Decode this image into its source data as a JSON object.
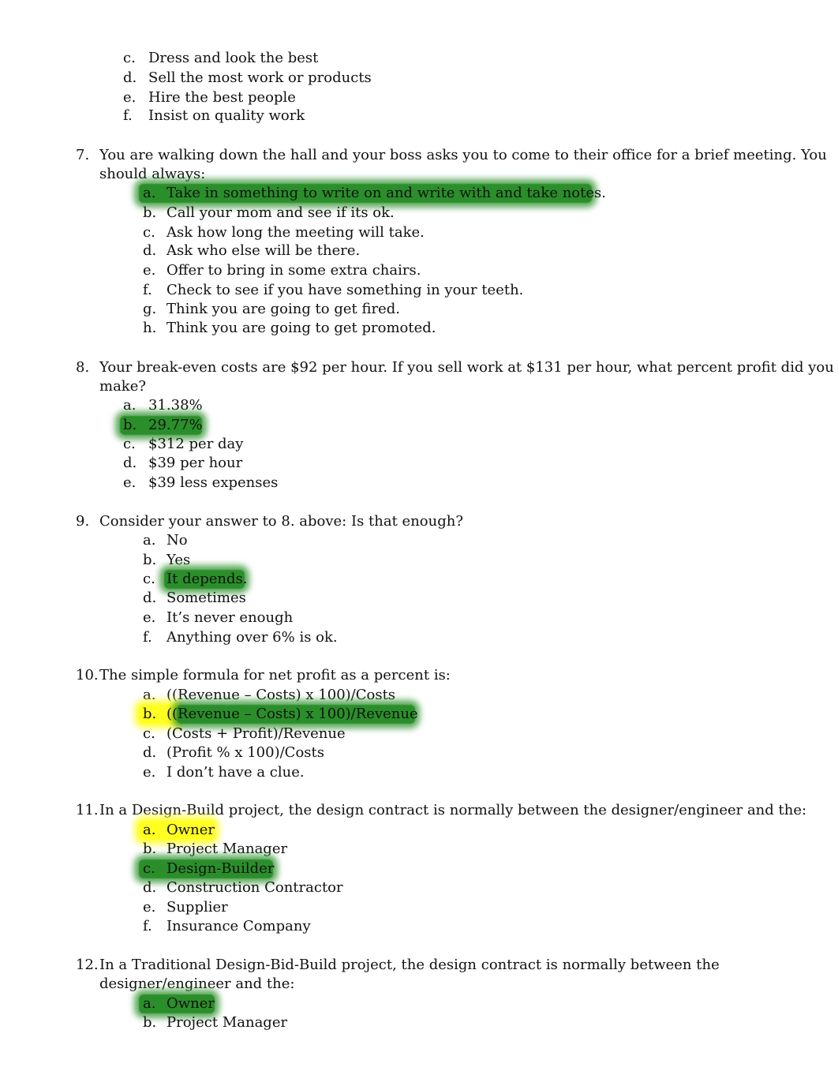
{
  "continued_question": {
    "options": [
      {
        "letter": "c.",
        "text": "Dress and look the best"
      },
      {
        "letter": "d.",
        "text": "Sell the most work or products"
      },
      {
        "letter": "e.",
        "text": "Hire the best people"
      },
      {
        "letter": "f.",
        "text": "Insist on quality work"
      }
    ]
  },
  "questions": [
    {
      "number": "7.",
      "lines": [
        "You are walking down the hall and your boss asks you to come to their office for a brief meeting.  You",
        "should always:"
      ],
      "options": [
        {
          "letter": "a.",
          "text": "Take in something to write on and write with and take notes.",
          "highlight": "green"
        },
        {
          "letter": "b.",
          "text": "Call your mom and see if its ok."
        },
        {
          "letter": "c.",
          "text": "Ask how long the meeting will take."
        },
        {
          "letter": "d.",
          "text": "Ask who else will be there."
        },
        {
          "letter": "e.",
          "text": "Offer to bring in some extra chairs."
        },
        {
          "letter": "f.",
          "text": "Check to see if you have something in your teeth."
        },
        {
          "letter": "g.",
          "text": "Think you are going to get fired."
        },
        {
          "letter": "h.",
          "text": "Think you are going to get promoted."
        }
      ]
    },
    {
      "number": "8.",
      "lines": [
        "Your break-even costs are $92 per hour.   If you sell work at $131 per hour, what percent profit did you",
        "make?"
      ],
      "options": [
        {
          "letter": "a.",
          "text": "31.38%"
        },
        {
          "letter": "b.",
          "text": "29.77%",
          "highlight": "green"
        },
        {
          "letter": "c.",
          "text": "$312 per day"
        },
        {
          "letter": "d.",
          "text": "$39 per hour"
        },
        {
          "letter": "e.",
          "text": "$39 less expenses"
        }
      ]
    },
    {
      "number": "9.",
      "lines": [
        "Consider your answer to 8. above:  Is that enough?"
      ],
      "options": [
        {
          "letter": "a.",
          "text": "No"
        },
        {
          "letter": "b.",
          "text": "Yes"
        },
        {
          "letter": "c.",
          "text": "It depends.",
          "highlight": "green"
        },
        {
          "letter": "d.",
          "text": "Sometimes"
        },
        {
          "letter": "e.",
          "text": "It’s never enough"
        },
        {
          "letter": "f.",
          "text": "Anything over 6% is ok."
        }
      ]
    },
    {
      "number": "10.",
      "lines": [
        "The simple formula for net profit as a percent is:"
      ],
      "options": [
        {
          "letter": "a.",
          "text": "((Revenue – Costs) x 100)/Costs"
        },
        {
          "letter": "b.",
          "text": "((Revenue – Costs) x 100)/Revenue",
          "highlight": "yellow-green"
        },
        {
          "letter": "c.",
          "text": "(Costs + Profit)/Revenue"
        },
        {
          "letter": "d.",
          "text": "(Profit % x 100)/Costs"
        },
        {
          "letter": "e.",
          "text": "I don’t have a clue."
        }
      ]
    },
    {
      "number": "11.",
      "lines": [
        "In a Design-Build project, the design contract is normally between the designer/engineer and the:"
      ],
      "options": [
        {
          "letter": "a.",
          "text": "Owner",
          "highlight": "yellow"
        },
        {
          "letter": "b.",
          "text": "Project Manager"
        },
        {
          "letter": "c.",
          "text": "Design-Builder",
          "highlight": "green"
        },
        {
          "letter": "d.",
          "text": "Construction Contractor"
        },
        {
          "letter": "e.",
          "text": "Supplier"
        },
        {
          "letter": "f.",
          "text": "Insurance Company"
        }
      ]
    },
    {
      "number": "12.",
      "lines": [
        "In a Traditional Design-Bid-Build project, the design contract is normally between the",
        "designer/engineer and the:"
      ],
      "options": [
        {
          "letter": "a.",
          "text": "Owner",
          "highlight": "green"
        },
        {
          "letter": "b.",
          "text": "Project Manager"
        }
      ]
    }
  ],
  "colors": {
    "highlight_green": "#2a8f2a",
    "highlight_yellow": "#ffff20"
  }
}
